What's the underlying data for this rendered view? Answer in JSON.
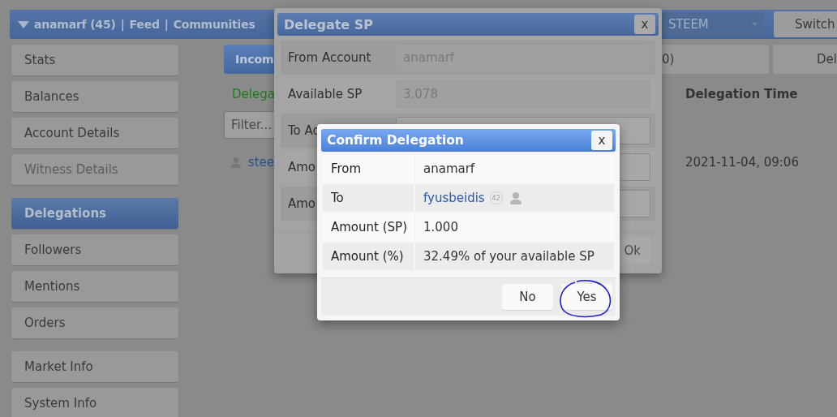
{
  "top_bar": {
    "nav": [
      {
        "kind": "menu",
        "text": "anamarf (45)"
      },
      {
        "kind": "separator",
        "text": "|"
      },
      {
        "kind": "link",
        "text": "Feed"
      },
      {
        "kind": "separator",
        "text": "|"
      },
      {
        "kind": "link",
        "text": "Communities"
      }
    ],
    "currency": "STEEM",
    "switch_button": "Switch"
  },
  "sidebar": {
    "groups": [
      [
        {
          "label": "Stats",
          "selected": false,
          "disabled": false
        },
        {
          "label": "Balances",
          "selected": false,
          "disabled": false
        },
        {
          "label": "Account Details",
          "selected": false,
          "disabled": false
        },
        {
          "label": "Witness Details",
          "selected": false,
          "disabled": true
        }
      ],
      [
        {
          "label": "Delegations",
          "selected": true,
          "disabled": false
        },
        {
          "label": "Followers",
          "selected": false,
          "disabled": false
        },
        {
          "label": "Mentions",
          "selected": false,
          "disabled": false
        },
        {
          "label": "Orders",
          "selected": false,
          "disabled": false
        }
      ],
      [
        {
          "label": "Market Info",
          "selected": false,
          "disabled": false
        },
        {
          "label": "System Info",
          "selected": false,
          "disabled": false
        }
      ]
    ]
  },
  "main": {
    "tabs": [
      {
        "label": "Incom",
        "selected": true
      },
      {
        "label": "0)",
        "selected": false
      },
      {
        "label": "Del",
        "selected": false
      }
    ],
    "columns": [
      "Delega",
      "Delegation Time"
    ],
    "filter": {
      "placeholder": "Filter..."
    },
    "rows": [
      {
        "account": "stee",
        "time": "2021-11-04, 09:06"
      }
    ]
  },
  "delegate_dialog": {
    "title": "Delegate SP",
    "close": "x",
    "fields": [
      {
        "label": "From Account",
        "value": "anamarf",
        "disabled": true
      },
      {
        "label": "Available SP",
        "value": "3.078",
        "disabled": true
      },
      {
        "label": "To Ac",
        "disabled": false
      },
      {
        "label": "Amo",
        "disabled": false
      },
      {
        "label": "Amo",
        "disabled": false
      }
    ],
    "ok_button": "Ok"
  },
  "confirm_dialog": {
    "title": "Confirm Delegation",
    "close": "x",
    "rows": [
      {
        "kind": "text",
        "label": "From",
        "value": "anamarf"
      },
      {
        "kind": "account",
        "label": "To",
        "value": "fyusbeidis",
        "reputation": "42"
      },
      {
        "kind": "text",
        "label": "Amount (SP)",
        "value": "1.000"
      },
      {
        "kind": "text",
        "label": "Amount (%)",
        "value": "32.49% of your available SP"
      }
    ],
    "buttons": [
      {
        "label": "No",
        "circled": false
      },
      {
        "label": "Yes",
        "circled": true
      }
    ]
  }
}
